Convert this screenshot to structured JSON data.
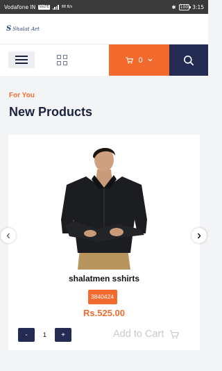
{
  "status_bar": {
    "carrier": "Vodafone IN",
    "volte": "VoLTE",
    "network_speed": "88 B/s",
    "battery": "100",
    "time": "3:15"
  },
  "header": {
    "logo_text": "Shalat Art"
  },
  "nav": {
    "cart_count": "0"
  },
  "section": {
    "subtitle": "For You",
    "title": "New Products"
  },
  "product": {
    "name": "shalatmen sshirts",
    "sku": "3840424",
    "price": "Rs.525.00",
    "quantity": "1",
    "minus_label": "-",
    "plus_label": "+",
    "add_to_cart_label": "Add to Cart"
  },
  "colors": {
    "accent": "#f26a2e",
    "navy": "#232b52",
    "background": "#f3f4f6"
  }
}
